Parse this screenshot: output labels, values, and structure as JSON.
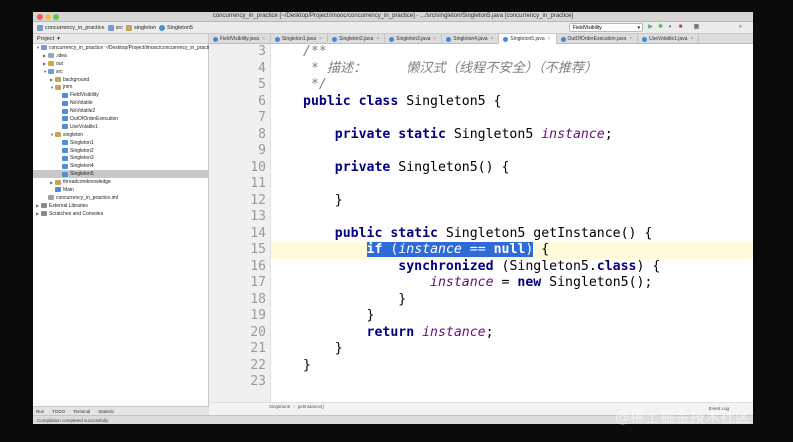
{
  "window": {
    "title": "concurrency_in_practice [~/Desktop/Project/imooc/concurrency_in_practice] - .../src/singleton/Singleton5.java [concurrency_in_practice]"
  },
  "nav": {
    "crumbs": [
      "concurrency_in_practice",
      "src",
      "singleton",
      "Singleton5"
    ],
    "run_config": "FieldVisibility"
  },
  "tabs": [
    {
      "label": "FieldVisibility.java",
      "active": false
    },
    {
      "label": "Singleton1.java",
      "active": false
    },
    {
      "label": "Singleton2.java",
      "active": false
    },
    {
      "label": "Singleton3.java",
      "active": false
    },
    {
      "label": "Singleton4.java",
      "active": false
    },
    {
      "label": "Singleton5.java",
      "active": true
    },
    {
      "label": "OutOfOrderExecution.java",
      "active": false
    },
    {
      "label": "UseVolatile1.java",
      "active": false
    }
  ],
  "project": {
    "header": "Project",
    "tree": [
      {
        "label": "concurrency_in_practice  ~/Desktop/Project/imooc/concurrency_in_practice",
        "indent": 0,
        "arrow": "▼",
        "icon": "#7a9cc6"
      },
      {
        "label": ".idea",
        "indent": 1,
        "arrow": "▶",
        "icon": "#9aa7b8"
      },
      {
        "label": "out",
        "indent": 1,
        "arrow": "▶",
        "icon": "#d9a441"
      },
      {
        "label": "src",
        "indent": 1,
        "arrow": "▼",
        "icon": "#6d9ecf"
      },
      {
        "label": "background",
        "indent": 2,
        "arrow": "▶",
        "icon": "#c9a35a"
      },
      {
        "label": "jmm",
        "indent": 2,
        "arrow": "▼",
        "icon": "#c9a35a"
      },
      {
        "label": "FieldVisibility",
        "indent": 3,
        "arrow": "",
        "icon": "#4f8fd0"
      },
      {
        "label": "NoVolatile",
        "indent": 3,
        "arrow": "",
        "icon": "#4f8fd0"
      },
      {
        "label": "NoVolatile2",
        "indent": 3,
        "arrow": "",
        "icon": "#4f8fd0"
      },
      {
        "label": "OutOfOrderExecution",
        "indent": 3,
        "arrow": "",
        "icon": "#4f8fd0"
      },
      {
        "label": "UseVolatile1",
        "indent": 3,
        "arrow": "",
        "icon": "#4f8fd0"
      },
      {
        "label": "singleton",
        "indent": 2,
        "arrow": "▼",
        "icon": "#c9a35a"
      },
      {
        "label": "Singleton1",
        "indent": 3,
        "arrow": "",
        "icon": "#4f8fd0"
      },
      {
        "label": "Singleton2",
        "indent": 3,
        "arrow": "",
        "icon": "#4f8fd0"
      },
      {
        "label": "Singleton3",
        "indent": 3,
        "arrow": "",
        "icon": "#4f8fd0"
      },
      {
        "label": "Singleton4",
        "indent": 3,
        "arrow": "",
        "icon": "#4f8fd0"
      },
      {
        "label": "Singleton5",
        "indent": 3,
        "arrow": "",
        "icon": "#4f8fd0",
        "selected": true
      },
      {
        "label": "threadcoreknowledge",
        "indent": 2,
        "arrow": "▶",
        "icon": "#c9a35a"
      },
      {
        "label": "Main",
        "indent": 2,
        "arrow": "",
        "icon": "#4f8fd0"
      },
      {
        "label": "concurrency_in_practice.iml",
        "indent": 1,
        "arrow": "",
        "icon": "#a0a0a0"
      },
      {
        "label": "External Libraries",
        "indent": 0,
        "arrow": "▶",
        "icon": "#8a8a8a"
      },
      {
        "label": "Scratches and Consoles",
        "indent": 0,
        "arrow": "▶",
        "icon": "#8a8a8a"
      }
    ]
  },
  "editor": {
    "first_line": 3,
    "caret_line": 15,
    "lines": [
      [
        {
          "t": "/**",
          "c": "cm"
        }
      ],
      [
        {
          "t": " * 描述：     懒汉式（线程不安全）（不推荐）",
          "c": "cm"
        }
      ],
      [
        {
          "t": " */",
          "c": "cm"
        }
      ],
      [
        {
          "t": "public class ",
          "c": "kw"
        },
        {
          "t": "Singleton5 {",
          "c": ""
        }
      ],
      [
        {
          "t": "",
          "c": ""
        }
      ],
      [
        {
          "t": "    private static ",
          "c": "kw"
        },
        {
          "t": "Singleton5 ",
          "c": ""
        },
        {
          "t": "instance",
          "c": "fld"
        },
        {
          "t": ";",
          "c": ""
        }
      ],
      [
        {
          "t": "",
          "c": ""
        }
      ],
      [
        {
          "t": "    private ",
          "c": "kw"
        },
        {
          "t": "Singleton5() {",
          "c": ""
        }
      ],
      [
        {
          "t": "",
          "c": ""
        }
      ],
      [
        {
          "t": "    }",
          "c": ""
        }
      ],
      [
        {
          "t": "",
          "c": ""
        }
      ],
      [
        {
          "t": "    public static ",
          "c": "kw"
        },
        {
          "t": "Singleton5 getInstance() {",
          "c": ""
        }
      ],
      [
        {
          "t": "        ",
          "c": ""
        },
        {
          "t": "if",
          "c": "kw sel"
        },
        {
          "t": " (",
          "c": "sel"
        },
        {
          "t": "instance",
          "c": "fld sel"
        },
        {
          "t": " == ",
          "c": "sel"
        },
        {
          "t": "null",
          "c": "kw sel"
        },
        {
          "t": ")",
          "c": "sel"
        },
        {
          "t": " {",
          "c": ""
        }
      ],
      [
        {
          "t": "            ",
          "c": ""
        },
        {
          "t": "synchronized ",
          "c": "kw"
        },
        {
          "t": "(Singleton5.",
          "c": ""
        },
        {
          "t": "class",
          "c": "kw"
        },
        {
          "t": ") {",
          "c": ""
        }
      ],
      [
        {
          "t": "                ",
          "c": ""
        },
        {
          "t": "instance",
          "c": "fld"
        },
        {
          "t": " = ",
          "c": ""
        },
        {
          "t": "new ",
          "c": "kw"
        },
        {
          "t": "Singleton5();",
          "c": ""
        }
      ],
      [
        {
          "t": "            }",
          "c": ""
        }
      ],
      [
        {
          "t": "        }",
          "c": ""
        }
      ],
      [
        {
          "t": "        ",
          "c": ""
        },
        {
          "t": "return ",
          "c": "kw"
        },
        {
          "t": "instance",
          "c": "fld"
        },
        {
          "t": ";",
          "c": ""
        }
      ],
      [
        {
          "t": "    }",
          "c": ""
        }
      ],
      [
        {
          "t": "}",
          "c": ""
        }
      ],
      [
        {
          "t": "",
          "c": ""
        }
      ]
    ]
  },
  "code_breadcrumb": [
    "Singleton5",
    "getInstance()"
  ],
  "status": {
    "items": [
      "Run",
      "TODO",
      "Terminal",
      "Statistic"
    ],
    "message": "Compilation completed successfully",
    "right": "Event Log"
  },
  "watermark": "@稀土掘金技术社区"
}
